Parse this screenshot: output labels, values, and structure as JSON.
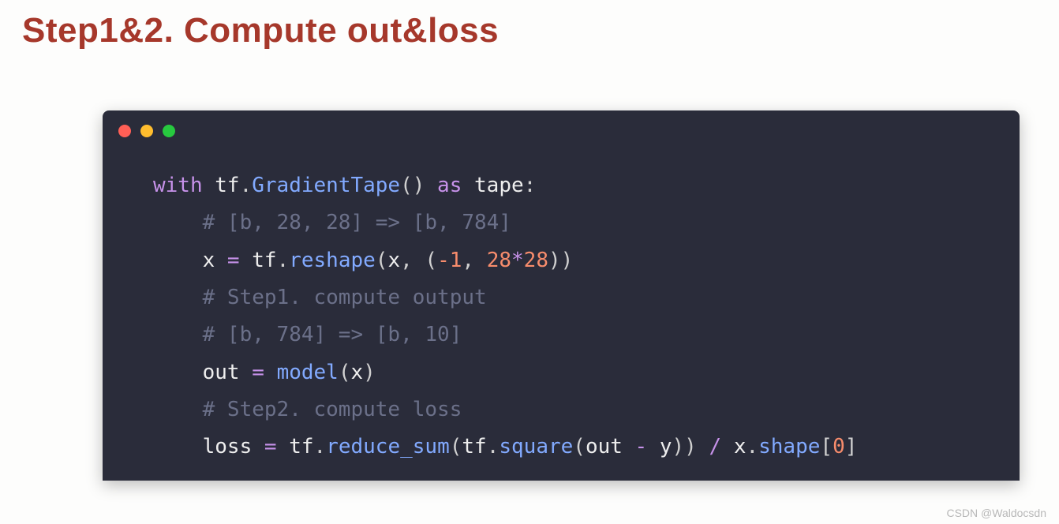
{
  "title": "Step1&2. Compute out&loss",
  "code": {
    "l1": {
      "with": "with",
      "tf": "tf",
      "dot1": ".",
      "grad": "GradientTape",
      "paren1": "()",
      "as": " as",
      "tape": " tape",
      "colon": ":"
    },
    "l2": "# [b, 28, 28] => [b, 784]",
    "l3": {
      "x": "x",
      "eq": " = ",
      "tf": "tf",
      "dot": ".",
      "reshape": "reshape",
      "lp": "(",
      "xarg": "x",
      "comma": ", (",
      "neg1": "-1",
      "comma2": ", ",
      "n28": "28",
      "star": "*",
      "n28b": "28",
      "rp": "))"
    },
    "l4": "# Step1. compute output",
    "l5": "# [b, 784] => [b, 10]",
    "l6": {
      "out": "out",
      "eq": " = ",
      "model": "model",
      "lp": "(",
      "x": "x",
      "rp": ")"
    },
    "l7": "# Step2. compute loss",
    "l8": {
      "loss": "loss",
      "eq": " = ",
      "tf": "tf",
      "dot": ".",
      "rs": "reduce_sum",
      "lp": "(",
      "tf2": "tf",
      "dot2": ".",
      "sq": "square",
      "lp2": "(",
      "out": "out",
      "minus": " - ",
      "y": "y",
      "rp2": "))",
      "slash": " / ",
      "x": "x",
      "dot3": ".",
      "shape": "shape",
      "lb": "[",
      "zero": "0",
      "rb": "]"
    }
  },
  "watermark": "CSDN @Waldocsdn"
}
